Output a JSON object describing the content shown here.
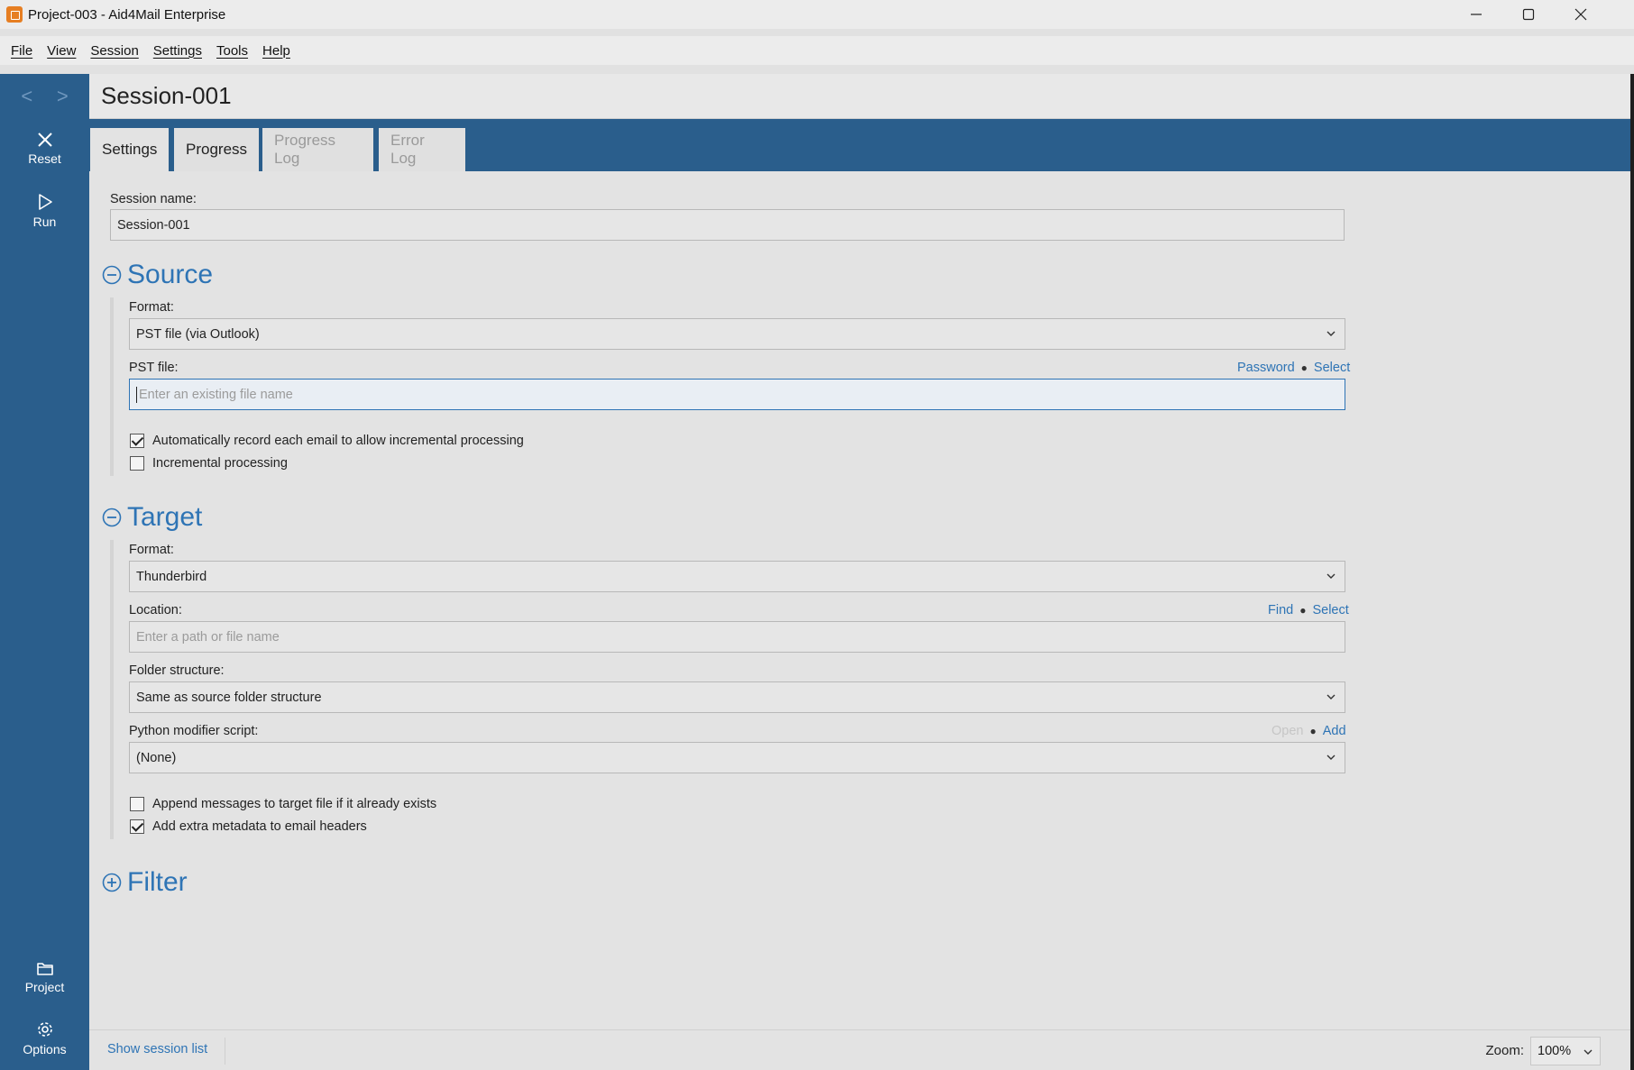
{
  "window": {
    "title": "Project-003 - Aid4Mail Enterprise",
    "controls": [
      "minimize-icon",
      "maximize-icon",
      "close-icon"
    ]
  },
  "menu": [
    "File",
    "View",
    "Session",
    "Settings",
    "Tools",
    "Help"
  ],
  "sidebar": {
    "back": "<",
    "forward": ">",
    "reset_label": "Reset",
    "run_label": "Run",
    "project_label": "Project",
    "options_label": "Options"
  },
  "header": {
    "title": "Session-001"
  },
  "tabs": [
    {
      "label": "Settings",
      "state": "active"
    },
    {
      "label": "Progress",
      "state": "normal"
    },
    {
      "label": "Progress Log",
      "state": "disabled"
    },
    {
      "label": "Error Log",
      "state": "disabled"
    }
  ],
  "session": {
    "name_label": "Session name:",
    "name_value": "Session-001"
  },
  "source": {
    "title": "Source",
    "format_label": "Format:",
    "format_value": "PST file (via Outlook)",
    "pst_label": "PST file:",
    "pst_link_password": "Password",
    "pst_link_select": "Select",
    "pst_placeholder": "Enter an existing file name",
    "check_auto_record": {
      "label": "Automatically record each email to allow incremental processing",
      "checked": true
    },
    "check_incremental": {
      "label": "Incremental processing",
      "checked": false
    }
  },
  "target": {
    "title": "Target",
    "format_label": "Format:",
    "format_value": "Thunderbird",
    "location_label": "Location:",
    "location_link_find": "Find",
    "location_link_select": "Select",
    "location_placeholder": "Enter a path or file name",
    "folder_label": "Folder structure:",
    "folder_value": "Same as source folder structure",
    "python_label": "Python modifier script:",
    "python_link_open": "Open",
    "python_link_add": "Add",
    "python_value": "(None)",
    "check_append": {
      "label": "Append messages to target file if it already exists",
      "checked": false
    },
    "check_metadata": {
      "label": "Add extra metadata to email headers",
      "checked": true
    }
  },
  "filter": {
    "title": "Filter"
  },
  "status": {
    "show_session_list": "Show session list",
    "zoom_label": "Zoom:",
    "zoom_value": "100%"
  },
  "colors": {
    "sidebar": "#2a5e8c",
    "accent": "#2e74b5",
    "background": "#e3e3e3"
  }
}
